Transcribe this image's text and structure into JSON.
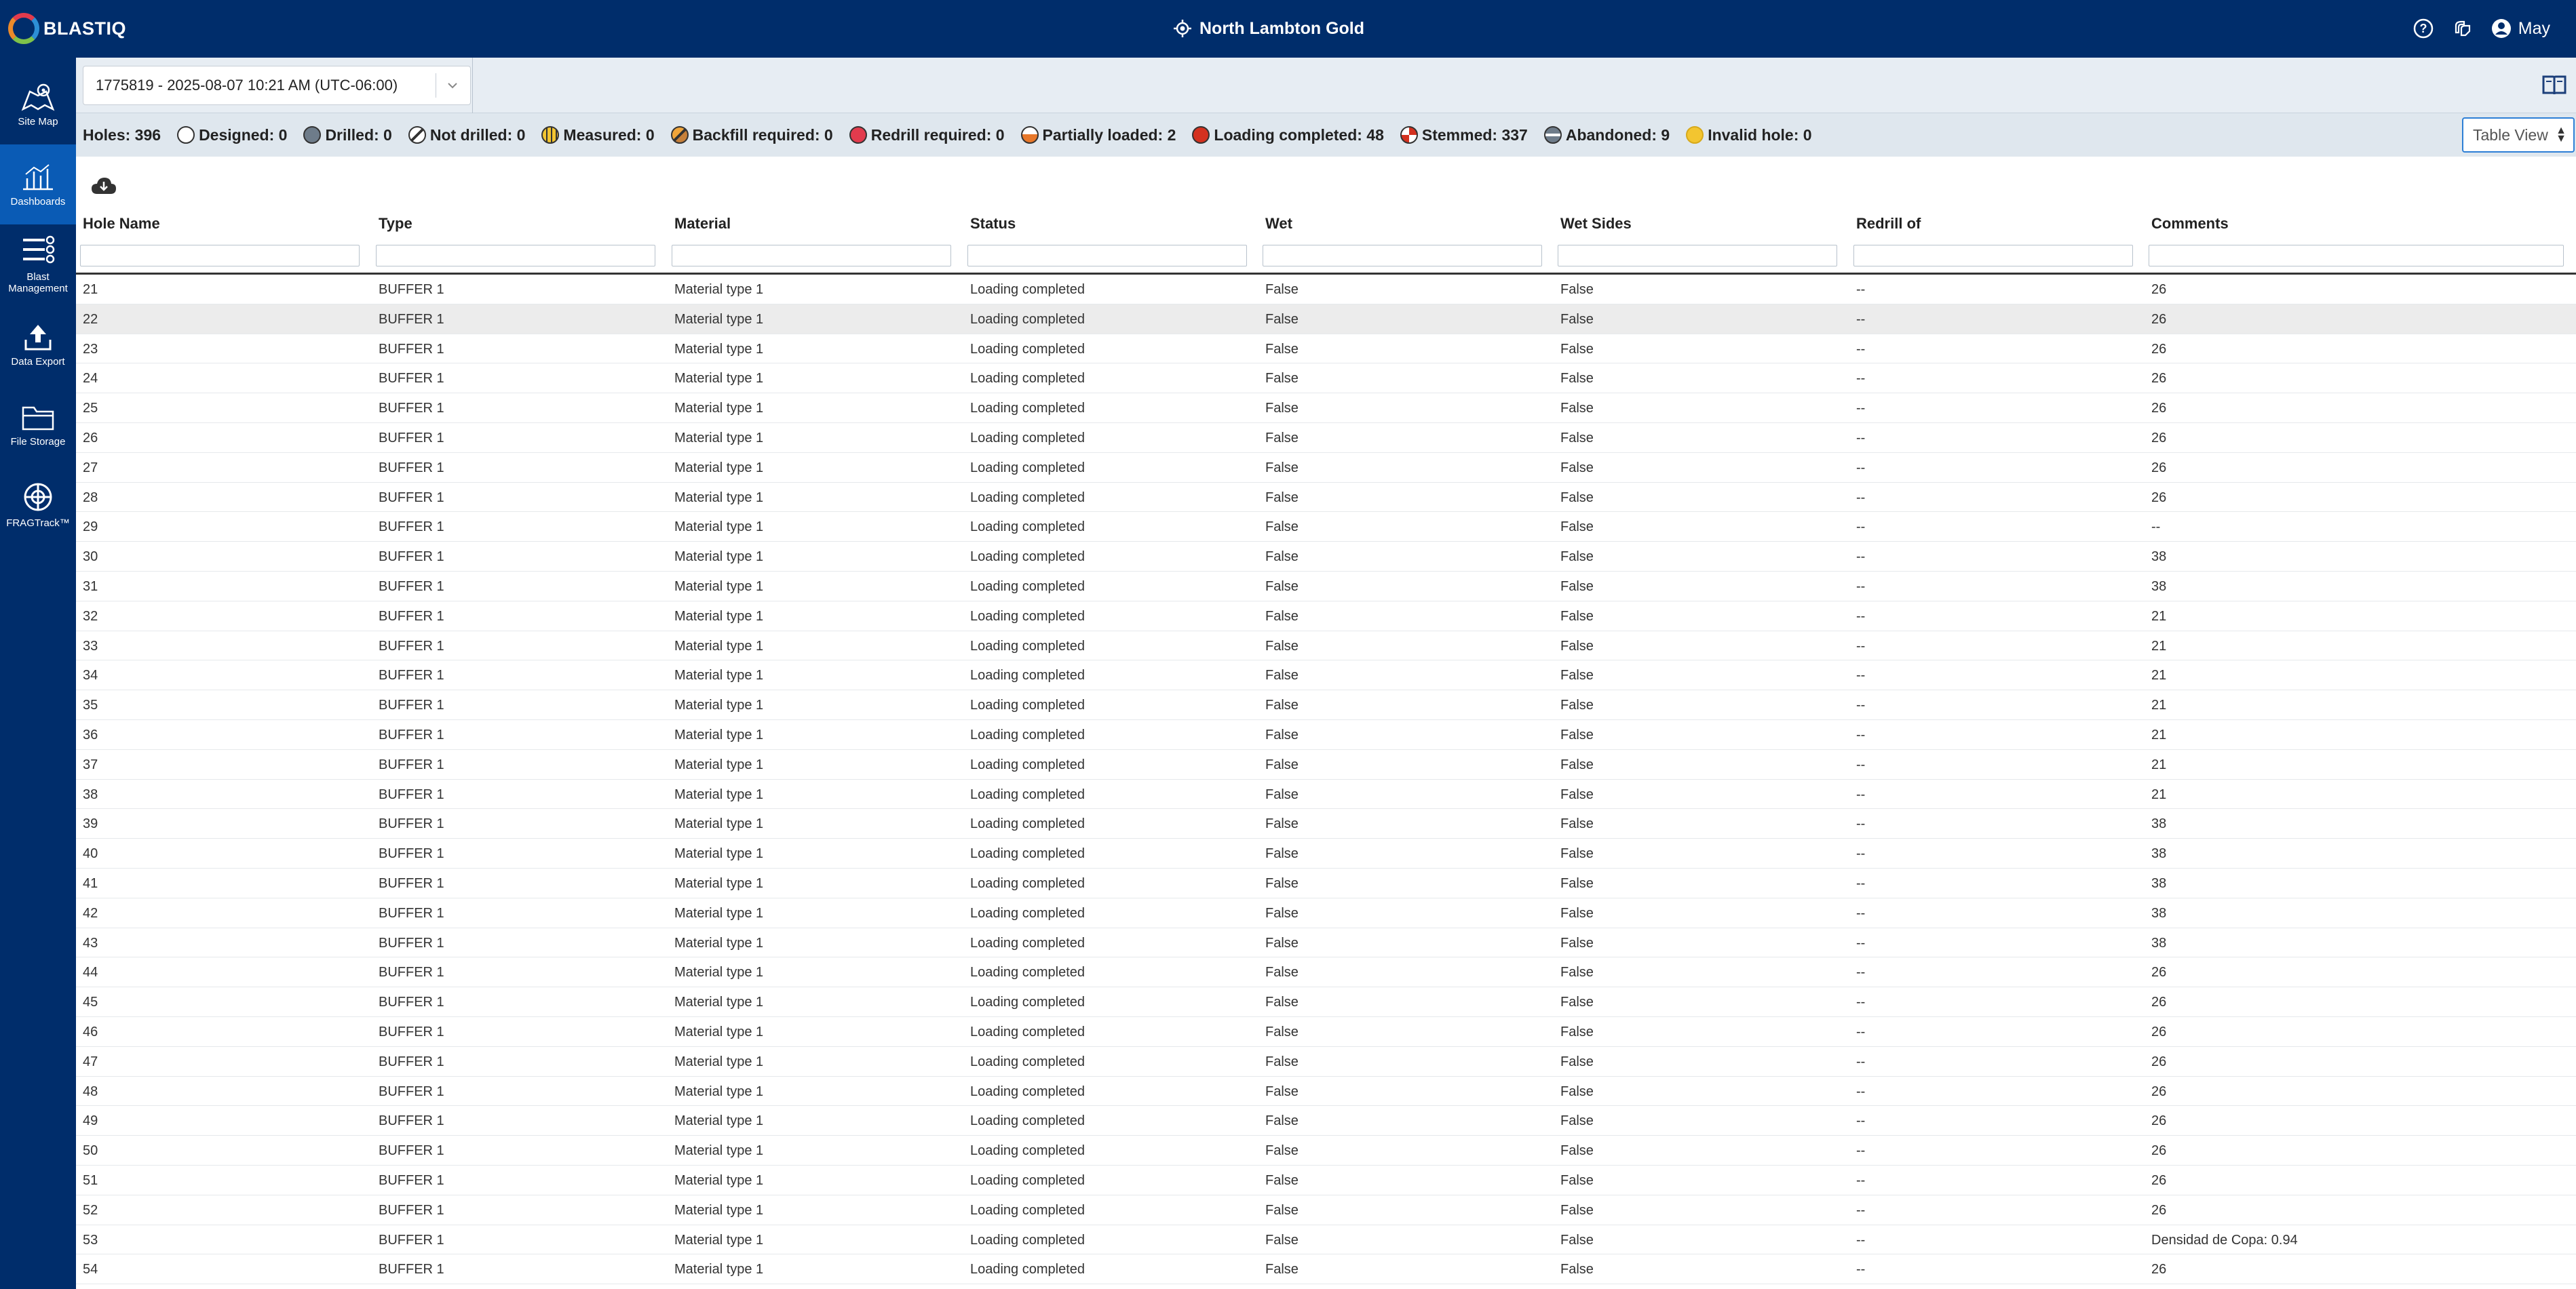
{
  "app": {
    "logo_text": "BLASTIQ",
    "site_name": "North Lambton Gold",
    "user_name": "May"
  },
  "nav": [
    {
      "label": "Site Map",
      "icon": "map-icon"
    },
    {
      "label": "Dashboards",
      "icon": "dashboard-icon"
    },
    {
      "label": "Blast Management",
      "icon": "blast-management-icon"
    },
    {
      "label": "Data Export",
      "icon": "upload-icon"
    },
    {
      "label": "File Storage",
      "icon": "folder-icon"
    },
    {
      "label": "FRAGTrack™",
      "icon": "fragtrack-icon"
    }
  ],
  "blast_selector": {
    "value": "1775819 - 2025-08-07 10:21 AM (UTC-06:00)"
  },
  "summary": {
    "holes": "Holes: 396",
    "designed": "Designed: 0",
    "drilled": "Drilled: 0",
    "not_drilled": "Not drilled: 0",
    "measured": "Measured: 0",
    "backfill": "Backfill required: 0",
    "redrill": "Redrill required: 0",
    "partial": "Partially loaded: 2",
    "loading": "Loading completed: 48",
    "stemmed": "Stemmed: 337",
    "abandoned": "Abandoned: 9",
    "invalid": "Invalid hole: 0"
  },
  "colors": {
    "header_bg": "#002d6b",
    "active_nav": "#0a5bb5",
    "loading_completed": "#d4311f",
    "invalid": "#f3c530",
    "drilled": "#6e7c8a"
  },
  "view_select": {
    "value": "Table View"
  },
  "columns": [
    "Hole Name",
    "Type",
    "Material",
    "Status",
    "Wet",
    "Wet Sides",
    "Redrill of",
    "Comments"
  ],
  "rows": [
    [
      "21",
      "BUFFER 1",
      "Material type 1",
      "Loading completed",
      "False",
      "False",
      "--",
      "26"
    ],
    [
      "22",
      "BUFFER 1",
      "Material type 1",
      "Loading completed",
      "False",
      "False",
      "--",
      "26"
    ],
    [
      "23",
      "BUFFER 1",
      "Material type 1",
      "Loading completed",
      "False",
      "False",
      "--",
      "26"
    ],
    [
      "24",
      "BUFFER 1",
      "Material type 1",
      "Loading completed",
      "False",
      "False",
      "--",
      "26"
    ],
    [
      "25",
      "BUFFER 1",
      "Material type 1",
      "Loading completed",
      "False",
      "False",
      "--",
      "26"
    ],
    [
      "26",
      "BUFFER 1",
      "Material type 1",
      "Loading completed",
      "False",
      "False",
      "--",
      "26"
    ],
    [
      "27",
      "BUFFER 1",
      "Material type 1",
      "Loading completed",
      "False",
      "False",
      "--",
      "26"
    ],
    [
      "28",
      "BUFFER 1",
      "Material type 1",
      "Loading completed",
      "False",
      "False",
      "--",
      "26"
    ],
    [
      "29",
      "BUFFER 1",
      "Material type 1",
      "Loading completed",
      "False",
      "False",
      "--",
      "--"
    ],
    [
      "30",
      "BUFFER 1",
      "Material type 1",
      "Loading completed",
      "False",
      "False",
      "--",
      "38"
    ],
    [
      "31",
      "BUFFER 1",
      "Material type 1",
      "Loading completed",
      "False",
      "False",
      "--",
      "38"
    ],
    [
      "32",
      "BUFFER 1",
      "Material type 1",
      "Loading completed",
      "False",
      "False",
      "--",
      "21"
    ],
    [
      "33",
      "BUFFER 1",
      "Material type 1",
      "Loading completed",
      "False",
      "False",
      "--",
      "21"
    ],
    [
      "34",
      "BUFFER 1",
      "Material type 1",
      "Loading completed",
      "False",
      "False",
      "--",
      "21"
    ],
    [
      "35",
      "BUFFER 1",
      "Material type 1",
      "Loading completed",
      "False",
      "False",
      "--",
      "21"
    ],
    [
      "36",
      "BUFFER 1",
      "Material type 1",
      "Loading completed",
      "False",
      "False",
      "--",
      "21"
    ],
    [
      "37",
      "BUFFER 1",
      "Material type 1",
      "Loading completed",
      "False",
      "False",
      "--",
      "21"
    ],
    [
      "38",
      "BUFFER 1",
      "Material type 1",
      "Loading completed",
      "False",
      "False",
      "--",
      "21"
    ],
    [
      "39",
      "BUFFER 1",
      "Material type 1",
      "Loading completed",
      "False",
      "False",
      "--",
      "38"
    ],
    [
      "40",
      "BUFFER 1",
      "Material type 1",
      "Loading completed",
      "False",
      "False",
      "--",
      "38"
    ],
    [
      "41",
      "BUFFER 1",
      "Material type 1",
      "Loading completed",
      "False",
      "False",
      "--",
      "38"
    ],
    [
      "42",
      "BUFFER 1",
      "Material type 1",
      "Loading completed",
      "False",
      "False",
      "--",
      "38"
    ],
    [
      "43",
      "BUFFER 1",
      "Material type 1",
      "Loading completed",
      "False",
      "False",
      "--",
      "38"
    ],
    [
      "44",
      "BUFFER 1",
      "Material type 1",
      "Loading completed",
      "False",
      "False",
      "--",
      "26"
    ],
    [
      "45",
      "BUFFER 1",
      "Material type 1",
      "Loading completed",
      "False",
      "False",
      "--",
      "26"
    ],
    [
      "46",
      "BUFFER 1",
      "Material type 1",
      "Loading completed",
      "False",
      "False",
      "--",
      "26"
    ],
    [
      "47",
      "BUFFER 1",
      "Material type 1",
      "Loading completed",
      "False",
      "False",
      "--",
      "26"
    ],
    [
      "48",
      "BUFFER 1",
      "Material type 1",
      "Loading completed",
      "False",
      "False",
      "--",
      "26"
    ],
    [
      "49",
      "BUFFER 1",
      "Material type 1",
      "Loading completed",
      "False",
      "False",
      "--",
      "26"
    ],
    [
      "50",
      "BUFFER 1",
      "Material type 1",
      "Loading completed",
      "False",
      "False",
      "--",
      "26"
    ],
    [
      "51",
      "BUFFER 1",
      "Material type 1",
      "Loading completed",
      "False",
      "False",
      "--",
      "26"
    ],
    [
      "52",
      "BUFFER 1",
      "Material type 1",
      "Loading completed",
      "False",
      "False",
      "--",
      "26"
    ],
    [
      "53",
      "BUFFER 1",
      "Material type 1",
      "Loading completed",
      "False",
      "False",
      "--",
      "Densidad de Copa: 0.94"
    ],
    [
      "54",
      "BUFFER 1",
      "Material type 1",
      "Loading completed",
      "False",
      "False",
      "--",
      "26"
    ]
  ]
}
